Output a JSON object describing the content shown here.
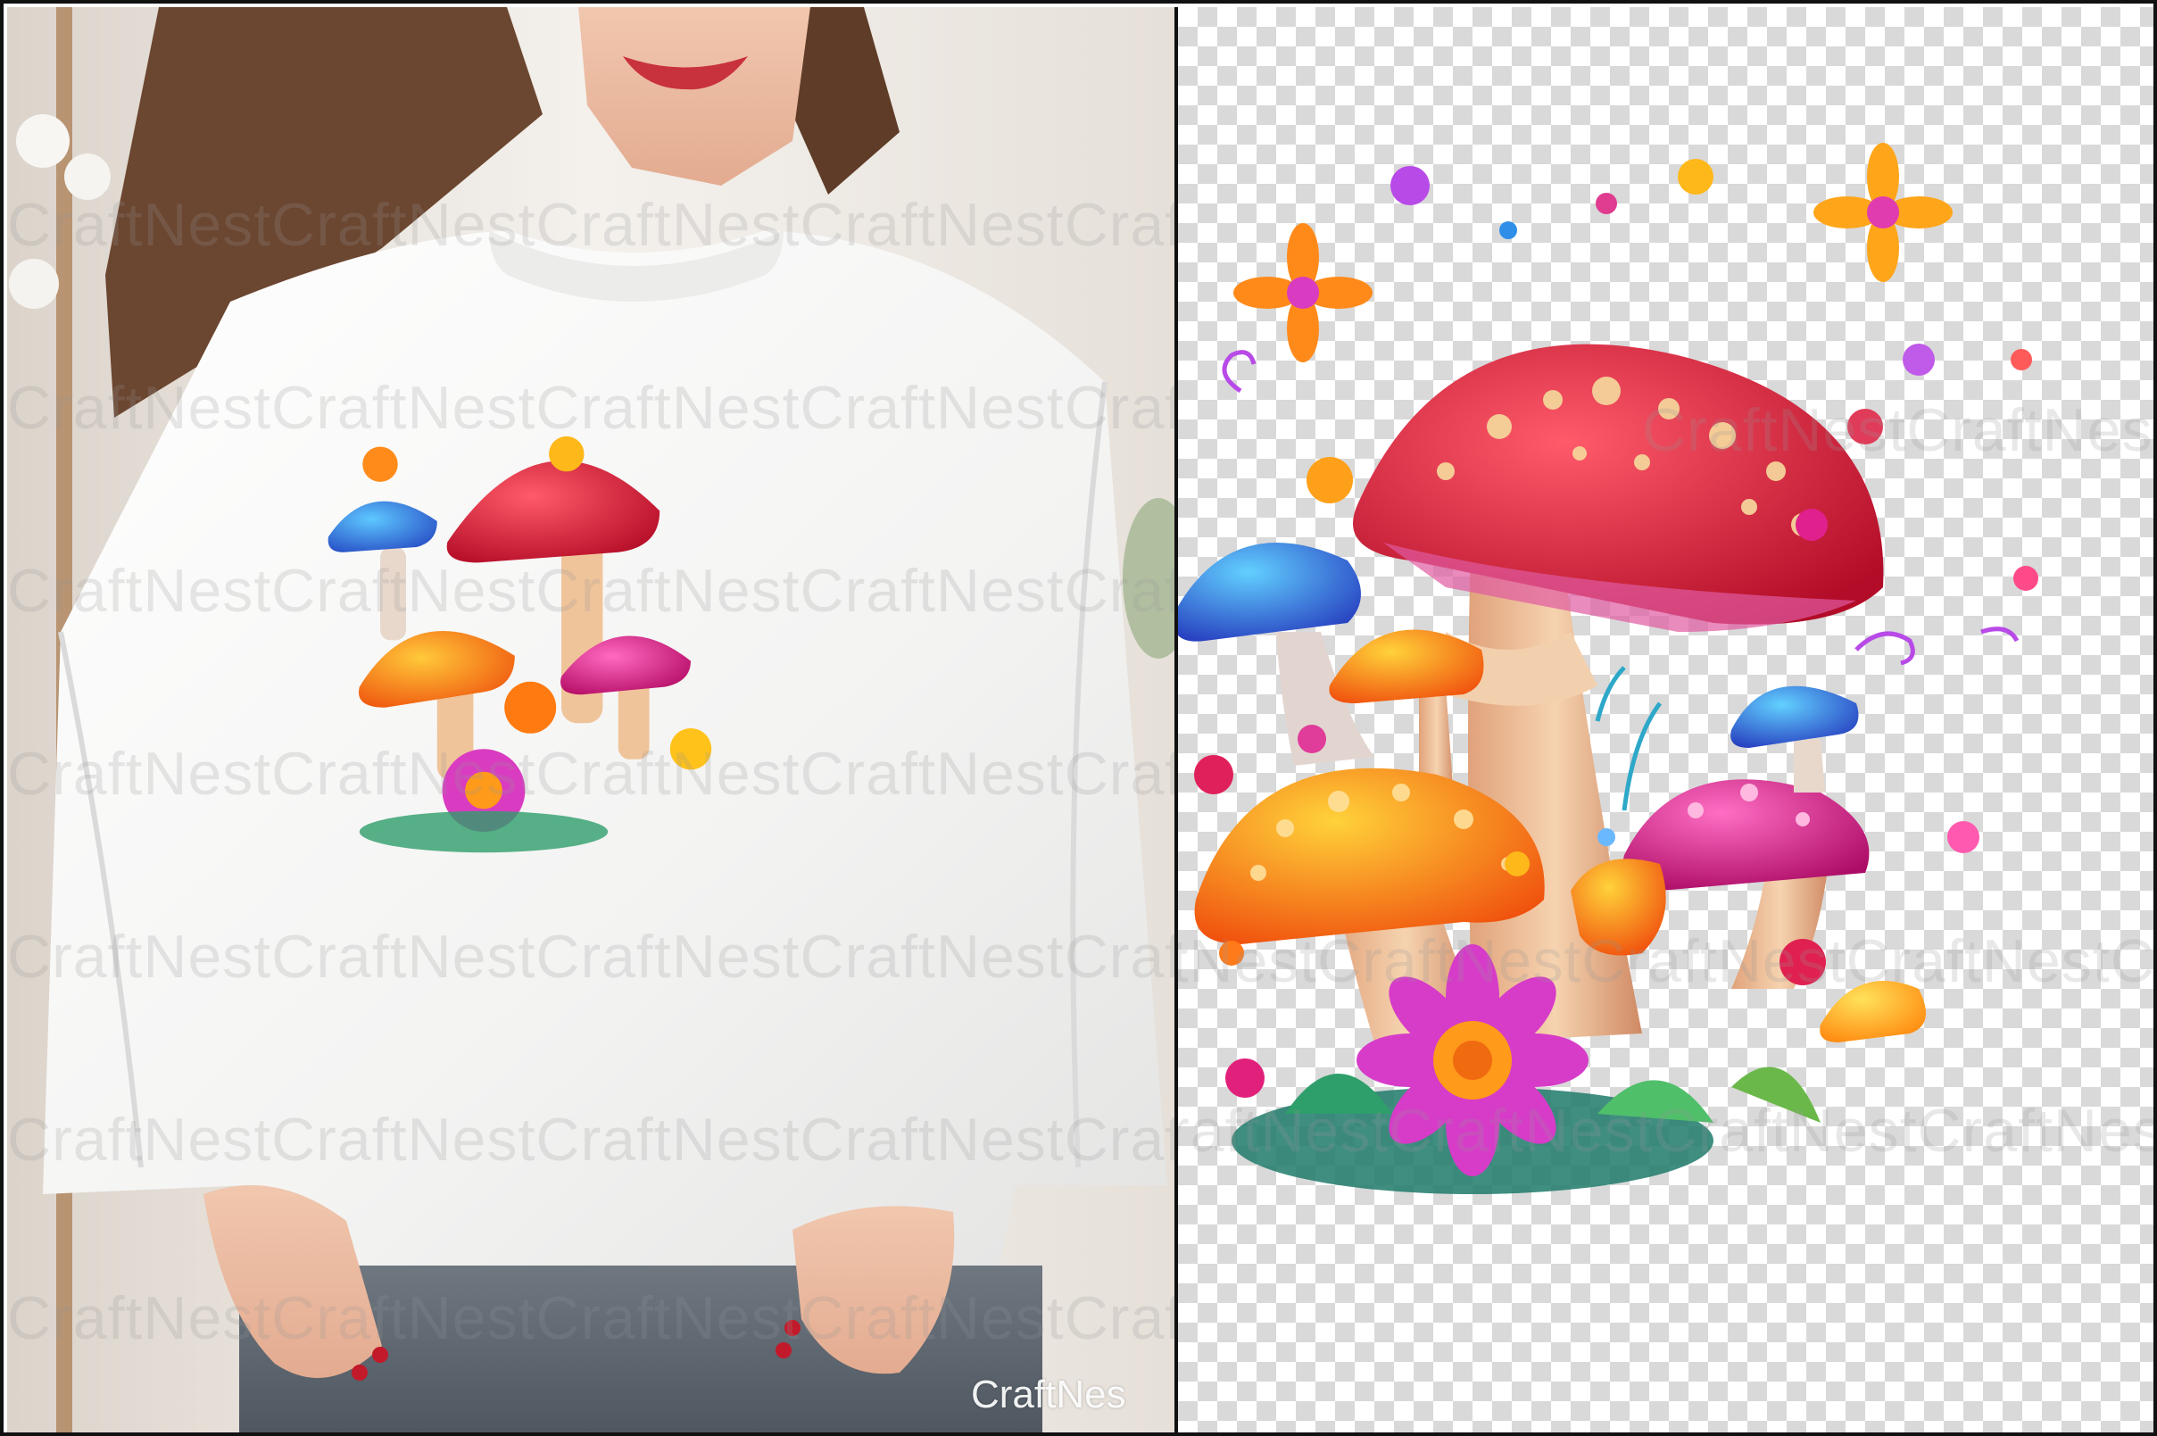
{
  "watermark": {
    "brand": "CraftNest",
    "row_text": "CraftNestCraftNestCraftNestCraftNestCraftNestCraftNestCraftNest",
    "corner_text": "CraftNes"
  },
  "colors": {
    "cap_red": "#e0203c",
    "cap_blue": "#2f8fe8",
    "cap_orange": "#ff8a1c",
    "cap_pink": "#e8248e",
    "cap_yellow": "#ffc21a",
    "stem": "#f2c9a0",
    "flower_purple": "#a23ee0",
    "leaf_green": "#2e9e6a",
    "sweatshirt": "#f7f7f6",
    "jeans": "#5d6670",
    "hair": "#6b4630",
    "checker": "#d9d9d9"
  },
  "panels": {
    "left": "mockup-photo",
    "right": "transparent-png-preview"
  }
}
